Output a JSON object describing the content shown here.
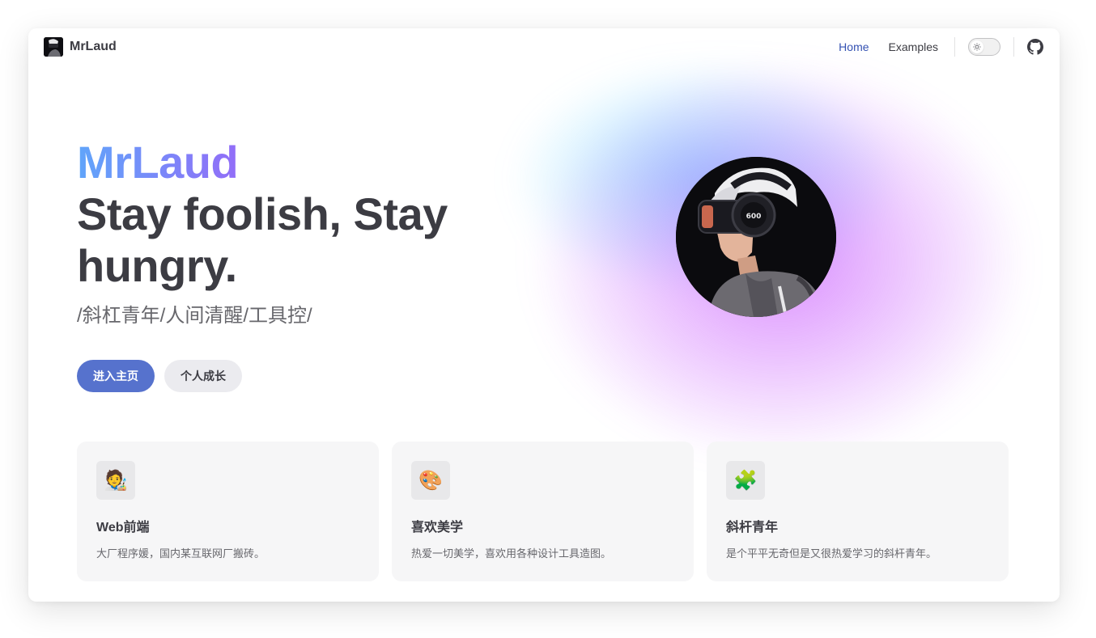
{
  "nav": {
    "brand": "MrLaud",
    "links": [
      {
        "label": "Home",
        "active": true
      },
      {
        "label": "Examples",
        "active": false
      }
    ]
  },
  "hero": {
    "name": "MrLaud",
    "tagline": "Stay foolish, Stay hungry.",
    "sub": "/斜杠青年/人间清醒/工具控/",
    "primary_action": "进入主页",
    "secondary_action": "个人成长",
    "avatar_text": "600"
  },
  "features": [
    {
      "icon": "🧑‍🎨",
      "icon_name": "artist-icon",
      "title": "Web前端",
      "desc": "大厂程序媛，国内某互联网厂搬砖。"
    },
    {
      "icon": "🎨",
      "icon_name": "palette-icon",
      "title": "喜欢美学",
      "desc": "热爱一切美学，喜欢用各种设计工具造图。"
    },
    {
      "icon": "🧩",
      "icon_name": "puzzle-icon",
      "title": "斜杆青年",
      "desc": "是个平平无奇但是又很热爱学习的斜杆青年。"
    }
  ],
  "colors": {
    "brand": "#5672cd",
    "active_link": "#3451b2",
    "text": "#3c3c43"
  }
}
